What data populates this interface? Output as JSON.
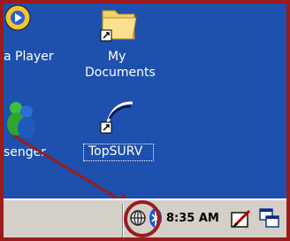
{
  "desktop": {
    "icons": [
      {
        "name": "media-player",
        "label": "a Player"
      },
      {
        "name": "my-documents",
        "label_line1": "My",
        "label_line2": "Documents"
      },
      {
        "name": "messenger",
        "label": "senger"
      },
      {
        "name": "topsurv",
        "label": "TopSURV"
      }
    ]
  },
  "taskbar": {
    "clock": "8:35 AM"
  },
  "colors": {
    "desktop": "#1e50ad",
    "annotation": "#9b1c1c",
    "taskbar": "#d4d0c8"
  }
}
